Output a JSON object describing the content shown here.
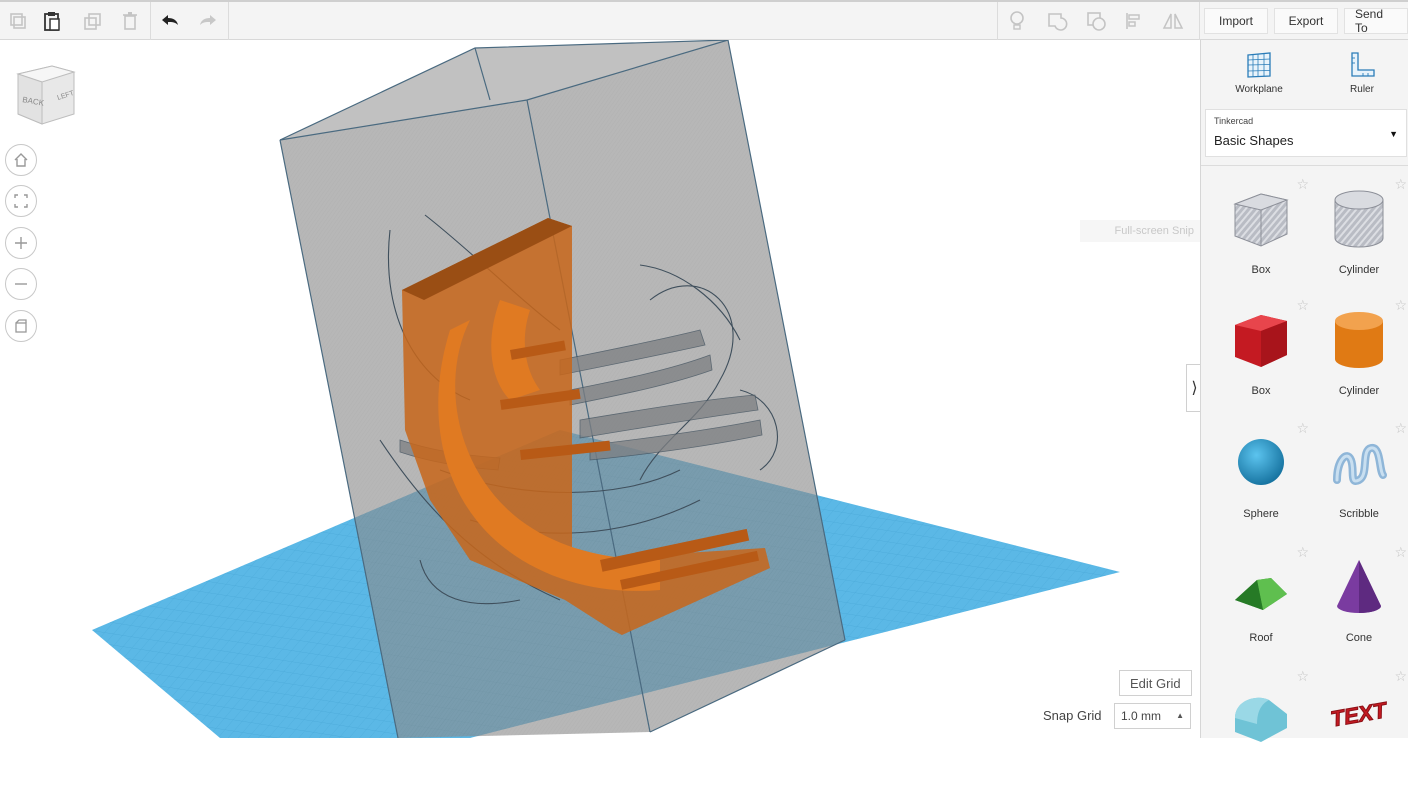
{
  "toolbar": {
    "import_label": "Import",
    "export_label": "Export",
    "send_to_label": "Send To"
  },
  "canvas": {
    "viewcube": {
      "faces": [
        "BACK",
        "LEFT"
      ]
    },
    "edit_grid_label": "Edit Grid",
    "snap_grid": {
      "label": "Snap Grid",
      "value": "1.0 mm"
    },
    "ghost_tooltip": "Full-screen Snip"
  },
  "panel": {
    "workplane_label": "Workplane",
    "ruler_label": "Ruler",
    "library": {
      "category": "Tinkercad",
      "selected": "Basic Shapes"
    },
    "shapes": [
      {
        "name": "Box",
        "icon": "box-striped-icon"
      },
      {
        "name": "Cylinder",
        "icon": "cylinder-striped-icon"
      },
      {
        "name": "Box",
        "icon": "box-red-icon"
      },
      {
        "name": "Cylinder",
        "icon": "cylinder-orange-icon"
      },
      {
        "name": "Sphere",
        "icon": "sphere-icon"
      },
      {
        "name": "Scribble",
        "icon": "scribble-icon"
      },
      {
        "name": "Roof",
        "icon": "roof-icon"
      },
      {
        "name": "Cone",
        "icon": "cone-icon"
      },
      {
        "name": "",
        "icon": "round-roof-icon"
      },
      {
        "name": "",
        "icon": "text-icon"
      }
    ]
  },
  "colors": {
    "workplane_blue": "#5bb8e6",
    "hole_gray": "#8c8c8c",
    "orange_part": "#d9741e",
    "red_box": "#d6202a",
    "sphere_blue": "#1e8ec4",
    "roof_green": "#3aa53a",
    "cone_purple": "#7a3ba0"
  }
}
